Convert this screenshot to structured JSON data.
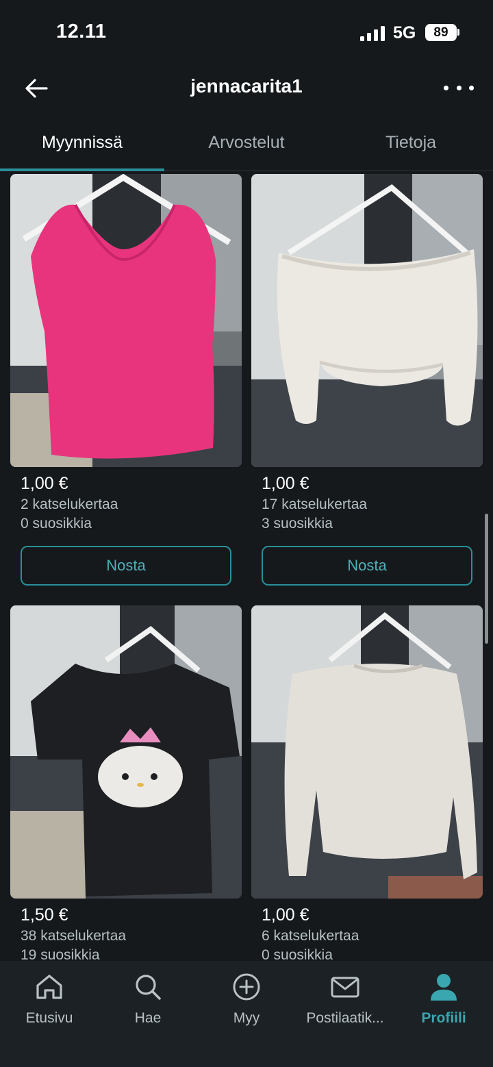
{
  "status_bar": {
    "time": "12.11",
    "network": "5G",
    "battery": "89"
  },
  "header": {
    "title": "jennacarita1"
  },
  "tabs": [
    {
      "label": "Myynnissä"
    },
    {
      "label": "Arvostelut"
    },
    {
      "label": "Tietoja"
    }
  ],
  "listings": [
    {
      "price": "1,00 €",
      "views": "2 katselukertaa",
      "favorites": "0 suosikkia",
      "button": "Nosta"
    },
    {
      "price": "1,00 €",
      "views": "17 katselukertaa",
      "favorites": "3 suosikkia",
      "button": "Nosta"
    },
    {
      "price": "1,50 €",
      "views": "38 katselukertaa",
      "favorites": "19 suosikkia"
    },
    {
      "price": "1,00 €",
      "views": "6 katselukertaa",
      "favorites": "0 suosikkia"
    }
  ],
  "bottom_nav": [
    {
      "label": "Etusivu",
      "icon": "home-icon"
    },
    {
      "label": "Hae",
      "icon": "search-icon"
    },
    {
      "label": "Myy",
      "icon": "plus-circle-icon"
    },
    {
      "label": "Postilaatik...",
      "icon": "mail-icon"
    },
    {
      "label": "Profiili",
      "icon": "profile-icon"
    }
  ],
  "colors": {
    "background": "#15191c",
    "accent": "#2a8f98",
    "nav_background": "#1b2124"
  }
}
